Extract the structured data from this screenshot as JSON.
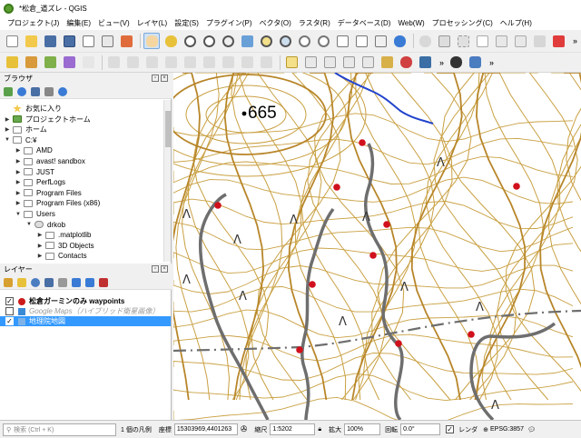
{
  "window": {
    "title": "*松倉_道ズレ - QGIS"
  },
  "menu": [
    "プロジェクト(J)",
    "編集(E)",
    "ビュー(V)",
    "レイヤ(L)",
    "設定(S)",
    "プラグイン(P)",
    "ベクタ(O)",
    "ラスタ(R)",
    "データベース(D)",
    "Web(W)",
    "プロセッシング(C)",
    "ヘルプ(H)"
  ],
  "browser_panel": {
    "title": "ブラウザ",
    "items": [
      {
        "label": "お気に入り",
        "level": 0,
        "arrow": ""
      },
      {
        "label": "プロジェクトホーム",
        "level": 0,
        "arrow": "▶"
      },
      {
        "label": "ホーム",
        "level": 0,
        "arrow": "▶"
      },
      {
        "label": "C:¥",
        "level": 0,
        "arrow": "▼"
      },
      {
        "label": "AMD",
        "level": 1,
        "arrow": "▶"
      },
      {
        "label": "avast! sandbox",
        "level": 1,
        "arrow": "▶"
      },
      {
        "label": "JUST",
        "level": 1,
        "arrow": "▶"
      },
      {
        "label": "PerfLogs",
        "level": 1,
        "arrow": "▶"
      },
      {
        "label": "Program Files",
        "level": 1,
        "arrow": "▶"
      },
      {
        "label": "Program Files (x86)",
        "level": 1,
        "arrow": "▶"
      },
      {
        "label": "Users",
        "level": 1,
        "arrow": "▼"
      },
      {
        "label": "drkob",
        "level": 2,
        "arrow": "▼"
      },
      {
        "label": ".matplotlib",
        "level": 3,
        "arrow": "▶"
      },
      {
        "label": "3D Objects",
        "level": 3,
        "arrow": "▶"
      },
      {
        "label": "Contacts",
        "level": 3,
        "arrow": "▶"
      }
    ]
  },
  "layers_panel": {
    "title": "レイヤー",
    "layers": [
      {
        "label": "松倉ガーミンのみ waypoints",
        "checked": "✓",
        "bold": true,
        "italic": false,
        "selected": false,
        "icon_color": "#cc1a1a"
      },
      {
        "label": "Google Maps（ハイブリッド衛星画像）",
        "checked": "",
        "bold": false,
        "italic": true,
        "selected": false,
        "icon_color": "#3b8ad6"
      },
      {
        "label": "地理院地図",
        "checked": "✓",
        "bold": false,
        "italic": false,
        "selected": true,
        "icon_color": "#7fb3e8"
      }
    ]
  },
  "map": {
    "elevation_label": "665",
    "contour_color": "#c9a042",
    "index_contour_color": "#b8862a",
    "road_color": "#6e6e6e",
    "river_color": "#2244cc",
    "waypoint_color": "#d0101c"
  },
  "status": {
    "search_placeholder": "検索 (Ctrl + K)",
    "legend_count": "1 個の凡例",
    "coord_label": "座標",
    "coord_value": "15303969,4401263",
    "scale_label": "縮尺",
    "scale_value": "1:5202",
    "magnifier_label": "拡大",
    "magnifier_value": "100%",
    "rotation_label": "回転",
    "rotation_value": "0.0°",
    "render_label": "レンダ",
    "crs": "EPSG:3857"
  }
}
